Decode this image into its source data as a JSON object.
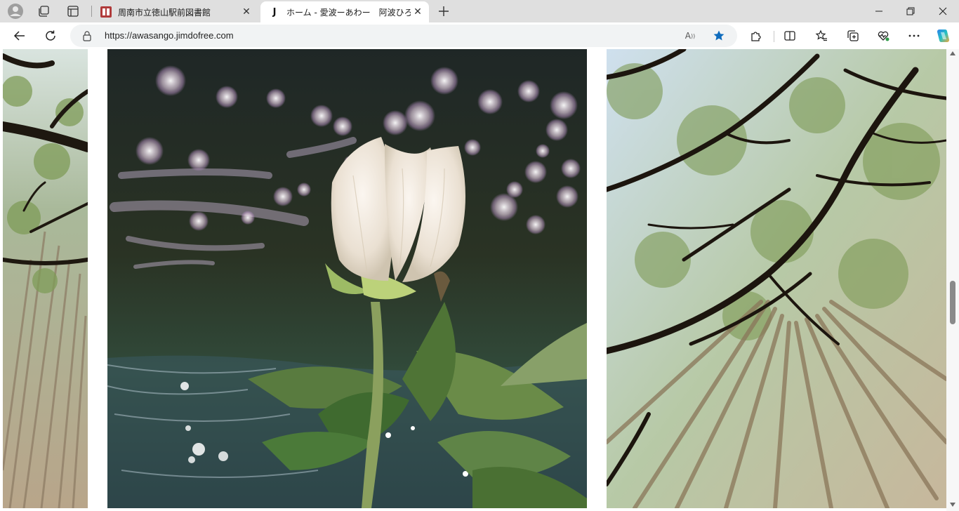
{
  "tabs": [
    {
      "title": "周南市立徳山駅前図書館",
      "active": false
    },
    {
      "title": "ホーム - 愛波ーあわー　阿波ひろみ公",
      "favicon_letter": "J",
      "active": true
    }
  ],
  "address_bar": {
    "url": "https://awasango.jimdofree.com",
    "read_aloud_label": "A",
    "favorite_active": true
  },
  "icons": {
    "profile": "avatar-icon",
    "workspaces": "workspaces-icon",
    "tab_actions": "vertical-tabs-icon",
    "back": "back-arrow-icon",
    "refresh": "refresh-icon",
    "extensions": "puzzle-icon",
    "split": "split-screen-icon",
    "favorites": "favorites-icon",
    "collections": "collections-icon",
    "performance": "heart-pulse-icon",
    "menu": "more-icon",
    "copilot": "copilot-icon"
  },
  "colors": {
    "accent_blue": "#0f6cbd",
    "tabstrip_bg": "#dfdfdf",
    "favicon_red": "#b03a3a"
  },
  "page": {
    "images": [
      {
        "subject": "forest-canopy-left"
      },
      {
        "subject": "white-flower-over-water"
      },
      {
        "subject": "forest-canopy-right"
      }
    ]
  }
}
